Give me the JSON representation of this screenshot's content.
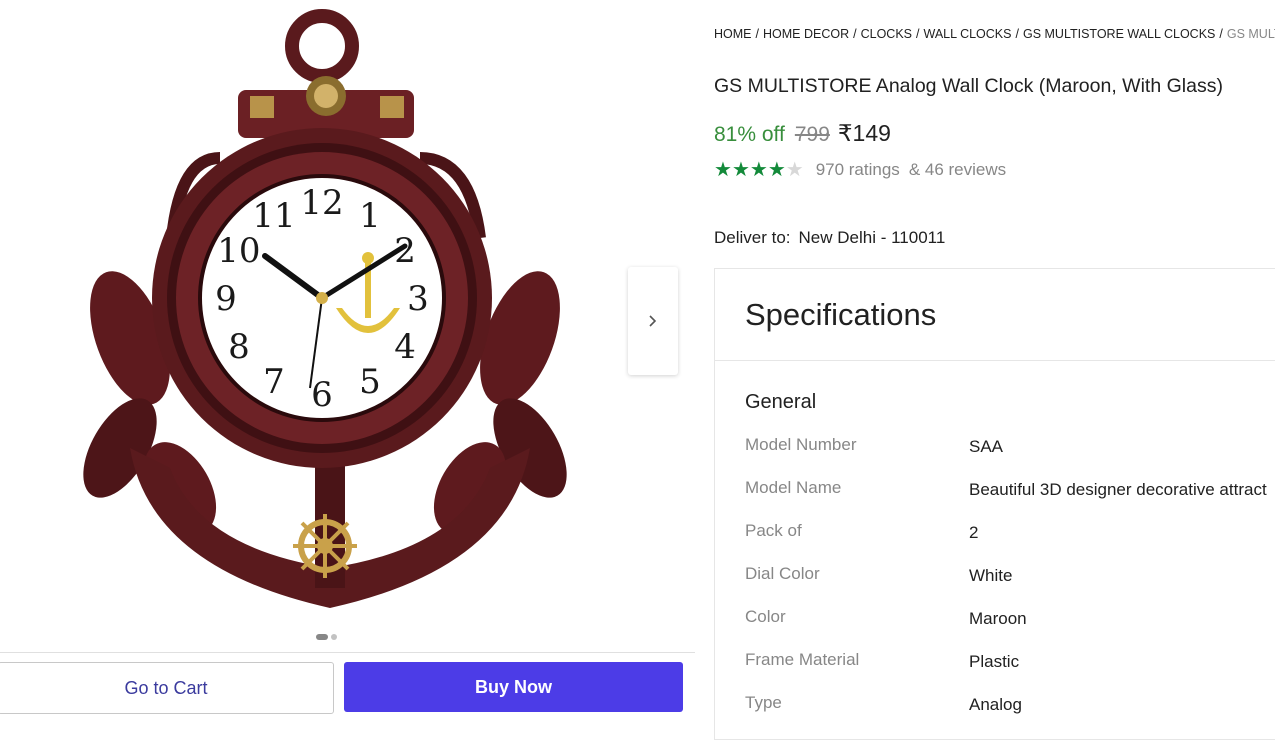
{
  "breadcrumb": [
    "HOME",
    "HOME DECOR",
    "CLOCKS",
    "WALL CLOCKS",
    "GS MULTISTORE WALL CLOCKS",
    "GS MULT"
  ],
  "product": {
    "title": "GS MULTISTORE Analog Wall Clock (Maroon, With Glass)",
    "discount": "81% off",
    "mrp": "799",
    "price": "₹149",
    "rating_value": 4,
    "ratings_text": "970 ratings",
    "reviews_text": "& 46 reviews"
  },
  "gallery": {
    "current_image": 1,
    "total_images": 2
  },
  "clock_face": [
    "12",
    "1",
    "2",
    "3",
    "4",
    "5",
    "6",
    "7",
    "8",
    "9",
    "10",
    "11"
  ],
  "delivery": {
    "label": "Deliver to:",
    "location": "New Delhi - 110011"
  },
  "specs": {
    "heading": "Specifications",
    "group": "General",
    "rows": [
      {
        "key": "Model Number",
        "value": "SAA"
      },
      {
        "key": "Model Name",
        "value": "Beautiful 3D designer decorative attract"
      },
      {
        "key": "Pack of",
        "value": "2"
      },
      {
        "key": "Dial Color",
        "value": "White"
      },
      {
        "key": "Color",
        "value": "Maroon"
      },
      {
        "key": "Frame Material",
        "value": "Plastic"
      },
      {
        "key": "Type",
        "value": "Analog"
      }
    ]
  },
  "actions": {
    "cart_label": "Go to Cart",
    "buy_label": "Buy Now"
  },
  "icons": {
    "next": "chevron-right-icon",
    "star": "star-icon"
  },
  "colors": {
    "accent": "#4c3ce7",
    "discount": "#388e3c",
    "star": "#138a3a",
    "frame": "#5a1a1d"
  }
}
